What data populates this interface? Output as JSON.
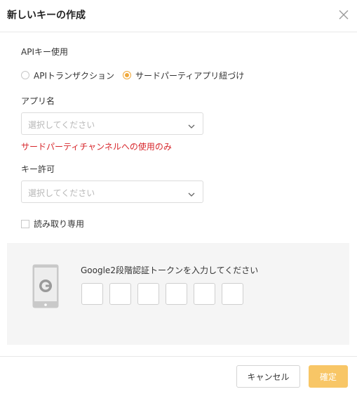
{
  "dialog": {
    "title": "新しいキーの作成"
  },
  "api_usage": {
    "label": "APIキー使用",
    "options": [
      {
        "label": "APIトランザクション",
        "checked": false
      },
      {
        "label": "サードパーティアプリ紐づけ",
        "checked": true
      }
    ]
  },
  "app_name": {
    "label": "アプリ名",
    "placeholder": "選択してください",
    "warning": "サードパーティチャンネルへの使用のみ"
  },
  "key_permission": {
    "label": "キー許可",
    "placeholder": "選択してください"
  },
  "read_only": {
    "label": "読み取り専用",
    "checked": false
  },
  "google_auth": {
    "prompt": "Google2段階認証トークンを入力してください",
    "code_length": 6
  },
  "footer": {
    "cancel_label": "キャンセル",
    "confirm_label": "確定"
  },
  "colors": {
    "accent": "#f0a83a",
    "confirm_button": "#f8c666",
    "warning_text": "#d7262b"
  }
}
